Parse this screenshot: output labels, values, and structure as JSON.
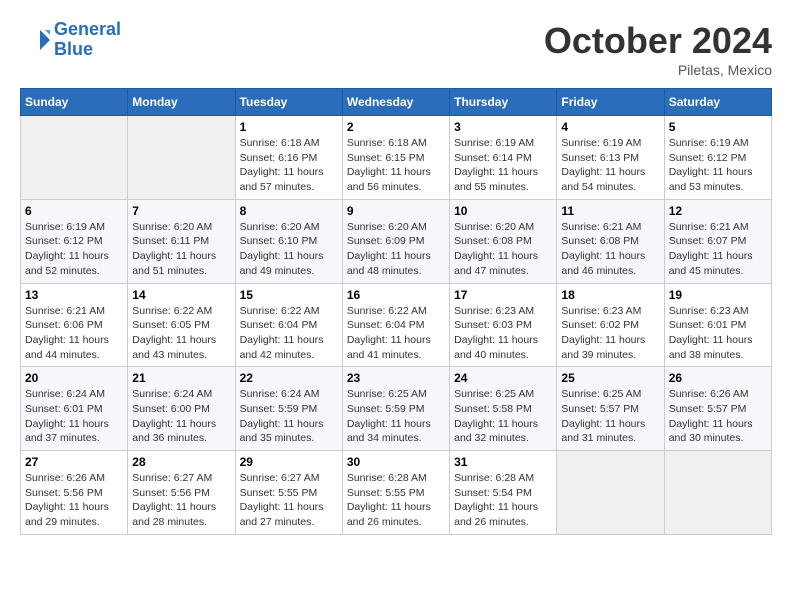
{
  "header": {
    "logo_line1": "General",
    "logo_line2": "Blue",
    "month_title": "October 2024",
    "subtitle": "Piletas, Mexico"
  },
  "weekdays": [
    "Sunday",
    "Monday",
    "Tuesday",
    "Wednesday",
    "Thursday",
    "Friday",
    "Saturday"
  ],
  "weeks": [
    [
      {
        "day": "",
        "empty": true
      },
      {
        "day": "",
        "empty": true
      },
      {
        "day": "1",
        "sunrise": "6:18 AM",
        "sunset": "6:16 PM",
        "daylight": "11 hours and 57 minutes."
      },
      {
        "day": "2",
        "sunrise": "6:18 AM",
        "sunset": "6:15 PM",
        "daylight": "11 hours and 56 minutes."
      },
      {
        "day": "3",
        "sunrise": "6:19 AM",
        "sunset": "6:14 PM",
        "daylight": "11 hours and 55 minutes."
      },
      {
        "day": "4",
        "sunrise": "6:19 AM",
        "sunset": "6:13 PM",
        "daylight": "11 hours and 54 minutes."
      },
      {
        "day": "5",
        "sunrise": "6:19 AM",
        "sunset": "6:12 PM",
        "daylight": "11 hours and 53 minutes."
      }
    ],
    [
      {
        "day": "6",
        "sunrise": "6:19 AM",
        "sunset": "6:12 PM",
        "daylight": "11 hours and 52 minutes."
      },
      {
        "day": "7",
        "sunrise": "6:20 AM",
        "sunset": "6:11 PM",
        "daylight": "11 hours and 51 minutes."
      },
      {
        "day": "8",
        "sunrise": "6:20 AM",
        "sunset": "6:10 PM",
        "daylight": "11 hours and 49 minutes."
      },
      {
        "day": "9",
        "sunrise": "6:20 AM",
        "sunset": "6:09 PM",
        "daylight": "11 hours and 48 minutes."
      },
      {
        "day": "10",
        "sunrise": "6:20 AM",
        "sunset": "6:08 PM",
        "daylight": "11 hours and 47 minutes."
      },
      {
        "day": "11",
        "sunrise": "6:21 AM",
        "sunset": "6:08 PM",
        "daylight": "11 hours and 46 minutes."
      },
      {
        "day": "12",
        "sunrise": "6:21 AM",
        "sunset": "6:07 PM",
        "daylight": "11 hours and 45 minutes."
      }
    ],
    [
      {
        "day": "13",
        "sunrise": "6:21 AM",
        "sunset": "6:06 PM",
        "daylight": "11 hours and 44 minutes."
      },
      {
        "day": "14",
        "sunrise": "6:22 AM",
        "sunset": "6:05 PM",
        "daylight": "11 hours and 43 minutes."
      },
      {
        "day": "15",
        "sunrise": "6:22 AM",
        "sunset": "6:04 PM",
        "daylight": "11 hours and 42 minutes."
      },
      {
        "day": "16",
        "sunrise": "6:22 AM",
        "sunset": "6:04 PM",
        "daylight": "11 hours and 41 minutes."
      },
      {
        "day": "17",
        "sunrise": "6:23 AM",
        "sunset": "6:03 PM",
        "daylight": "11 hours and 40 minutes."
      },
      {
        "day": "18",
        "sunrise": "6:23 AM",
        "sunset": "6:02 PM",
        "daylight": "11 hours and 39 minutes."
      },
      {
        "day": "19",
        "sunrise": "6:23 AM",
        "sunset": "6:01 PM",
        "daylight": "11 hours and 38 minutes."
      }
    ],
    [
      {
        "day": "20",
        "sunrise": "6:24 AM",
        "sunset": "6:01 PM",
        "daylight": "11 hours and 37 minutes."
      },
      {
        "day": "21",
        "sunrise": "6:24 AM",
        "sunset": "6:00 PM",
        "daylight": "11 hours and 36 minutes."
      },
      {
        "day": "22",
        "sunrise": "6:24 AM",
        "sunset": "5:59 PM",
        "daylight": "11 hours and 35 minutes."
      },
      {
        "day": "23",
        "sunrise": "6:25 AM",
        "sunset": "5:59 PM",
        "daylight": "11 hours and 34 minutes."
      },
      {
        "day": "24",
        "sunrise": "6:25 AM",
        "sunset": "5:58 PM",
        "daylight": "11 hours and 32 minutes."
      },
      {
        "day": "25",
        "sunrise": "6:25 AM",
        "sunset": "5:57 PM",
        "daylight": "11 hours and 31 minutes."
      },
      {
        "day": "26",
        "sunrise": "6:26 AM",
        "sunset": "5:57 PM",
        "daylight": "11 hours and 30 minutes."
      }
    ],
    [
      {
        "day": "27",
        "sunrise": "6:26 AM",
        "sunset": "5:56 PM",
        "daylight": "11 hours and 29 minutes."
      },
      {
        "day": "28",
        "sunrise": "6:27 AM",
        "sunset": "5:56 PM",
        "daylight": "11 hours and 28 minutes."
      },
      {
        "day": "29",
        "sunrise": "6:27 AM",
        "sunset": "5:55 PM",
        "daylight": "11 hours and 27 minutes."
      },
      {
        "day": "30",
        "sunrise": "6:28 AM",
        "sunset": "5:55 PM",
        "daylight": "11 hours and 26 minutes."
      },
      {
        "day": "31",
        "sunrise": "6:28 AM",
        "sunset": "5:54 PM",
        "daylight": "11 hours and 26 minutes."
      },
      {
        "day": "",
        "empty": true
      },
      {
        "day": "",
        "empty": true
      }
    ]
  ],
  "labels": {
    "sunrise": "Sunrise: ",
    "sunset": "Sunset: ",
    "daylight": "Daylight: "
  }
}
